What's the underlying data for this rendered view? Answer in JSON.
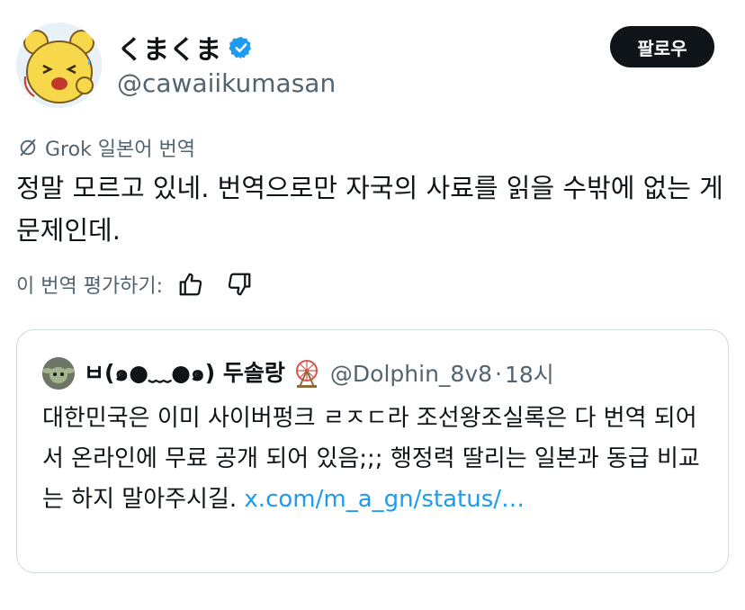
{
  "author": {
    "display_name": "くまくま",
    "handle": "@cawaiikumasan",
    "verified": true,
    "follow_label": "팔로우"
  },
  "translation": {
    "label": "Grok 일본어 번역",
    "text": "정말 모르고 있네. 번역으로만 자국의 사료를 읽을 수밖에 없는 게 문제인데.",
    "rate_label": "이 번역 평가하기:"
  },
  "quote": {
    "name": "ㅂ(๑●﹏●๑) 두솔랑",
    "handle": "@Dolphin_8v8",
    "separator": "·",
    "time": "18시",
    "text": "대한민국은 이미 사이버펑크 ㄹㅈㄷ라 조선왕조실록은 다 번역 되어서 온라인에 무료 공개 되어 있음;;; 행정력 딸리는 일본과 동급 비교는 하지 말아주시길. ",
    "link": "x.com/m_a_gn/status/…"
  },
  "colors": {
    "text": "#0f1419",
    "secondary": "#536471",
    "link": "#1d9bf0",
    "verified": "#1d9bf0",
    "follow_bg": "#0f1419",
    "border": "#cfd9de"
  }
}
